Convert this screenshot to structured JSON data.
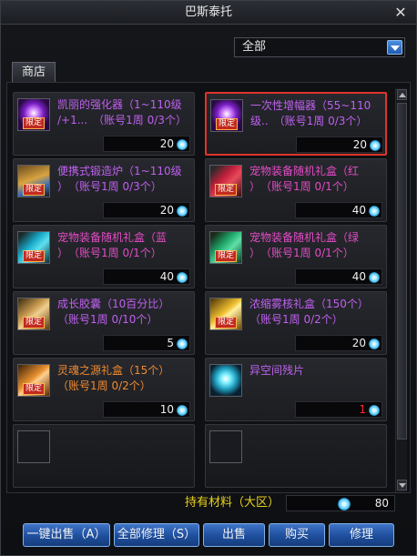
{
  "window": {
    "title": "巴斯泰托"
  },
  "filter": {
    "selected": "全部"
  },
  "tabs": [
    {
      "label": "商店"
    }
  ],
  "items": [
    {
      "name": "凯丽的强化器（1~110级",
      "limit": "/+1...　（账号1周 0/3个）",
      "price": "20",
      "color": "#c060f0",
      "tag": "限定",
      "icon": "purple-orb-icon"
    },
    {
      "name": "一次性增幅器（55~110",
      "limit": "级..　（账号1周 0/3个）",
      "price": "20",
      "color": "#c060f0",
      "tag": "限定",
      "icon": "purple-orb-icon",
      "selected": true
    },
    {
      "name": "便携式锻造炉（1~110级",
      "limit": "）　（账号1周 0/3个）",
      "price": "20",
      "color": "#c060f0",
      "tag": "限定",
      "icon": "forge-icon"
    },
    {
      "name": "宠物装备随机礼盒（红",
      "limit": "）　（账号1周 0/1个）",
      "price": "40",
      "color": "#e44cc6",
      "tag": "限定",
      "icon": "red-gift-box-icon"
    },
    {
      "name": "宠物装备随机礼盒（蓝",
      "limit": "）　（账号1周 0/1个）",
      "price": "40",
      "color": "#e44cc6",
      "tag": "限定",
      "icon": "blue-gift-box-icon"
    },
    {
      "name": "宠物装备随机礼盒（绿",
      "limit": "）　（账号1周 0/1个）",
      "price": "40",
      "color": "#e44cc6",
      "tag": "限定",
      "icon": "green-gift-box-icon"
    },
    {
      "name": "成长胶囊（10百分比）",
      "limit": "（账号1周 0/10个）",
      "price": "5",
      "color": "#c060f0",
      "tag": "限定",
      "icon": "capsule-icon"
    },
    {
      "name": "浓缩雾核礼盒（150个）",
      "limit": "（账号1周 0/2个）",
      "price": "20",
      "color": "#c060f0",
      "tag": "限定",
      "icon": "gold-box-icon"
    },
    {
      "name": "灵魂之源礼盒（15个）",
      "limit": "（账号1周 0/2个）",
      "price": "10",
      "color": "#f08a30",
      "tag": "限定",
      "icon": "soul-box-icon"
    },
    {
      "name": "异空间残片",
      "limit": "",
      "price": "1",
      "color": "#c060f0",
      "tag": "",
      "icon": "crystal-shard-icon",
      "price_color": "#ff2a2a"
    }
  ],
  "currency": {
    "label": "持有材料（大区）",
    "value": "80",
    "icon": "gem-icon"
  },
  "buttons": {
    "sell_all": "一键出售（A）",
    "repair_all": "全部修理（S）",
    "sell": "出售",
    "buy": "购买",
    "repair": "修理"
  }
}
